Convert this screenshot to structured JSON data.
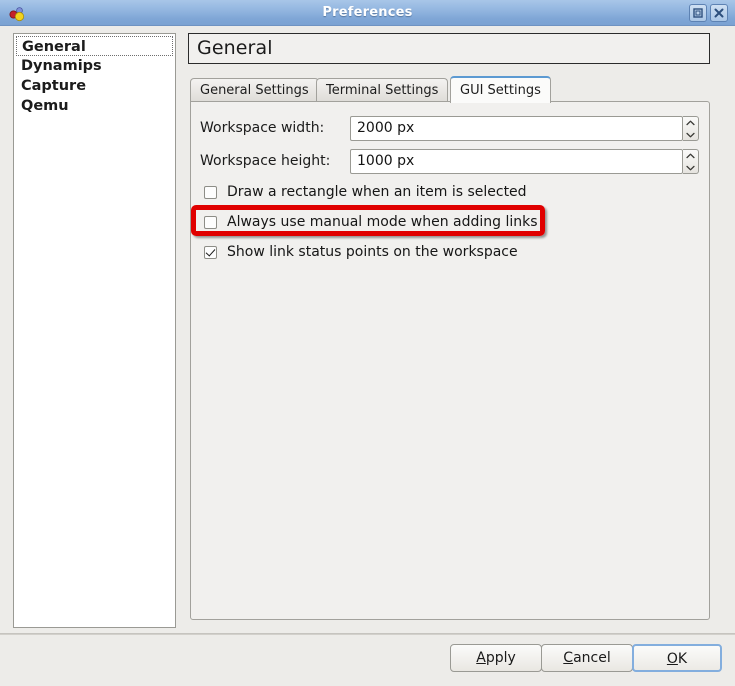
{
  "window": {
    "title": "Preferences",
    "app_icon": "gns3-balls-icon",
    "buttons": {
      "maximize": "maximize-icon",
      "close": "close-icon"
    }
  },
  "sidebar": {
    "items": [
      {
        "label": "General",
        "selected": true
      },
      {
        "label": "Dynamips",
        "selected": false
      },
      {
        "label": "Capture",
        "selected": false
      },
      {
        "label": "Qemu",
        "selected": false
      }
    ]
  },
  "header": {
    "title": "General"
  },
  "tabs": [
    {
      "label": "General Settings",
      "active": false
    },
    {
      "label": "Terminal Settings",
      "active": false
    },
    {
      "label": "GUI Settings",
      "active": true
    }
  ],
  "form": {
    "fields": [
      {
        "label": "Workspace width:",
        "value": "2000 px",
        "spinner": true
      },
      {
        "label": "Workspace height:",
        "value": "1000 px",
        "spinner": true
      }
    ],
    "checkboxes": [
      {
        "label": "Draw a rectangle when an item is selected",
        "checked": false,
        "highlighted": false
      },
      {
        "label": "Always use manual mode when adding links",
        "checked": false,
        "highlighted": true
      },
      {
        "label": "Show link status points on the workspace",
        "checked": true,
        "highlighted": false
      }
    ]
  },
  "footer": {
    "apply": {
      "label": "Apply",
      "accel": "A"
    },
    "cancel": {
      "label": "Cancel",
      "accel": "C"
    },
    "ok": {
      "label": "OK",
      "accel": "O",
      "focused": true
    }
  },
  "colors": {
    "titlebar_top": "#a8c6e8",
    "titlebar_bottom": "#7ba2d2",
    "dialog_bg": "#edece9",
    "panel_bg": "#f1f0ee",
    "annotation_red": "#e00000",
    "tab_accent": "#5c9ad2",
    "focus_blue": "#83aede"
  }
}
